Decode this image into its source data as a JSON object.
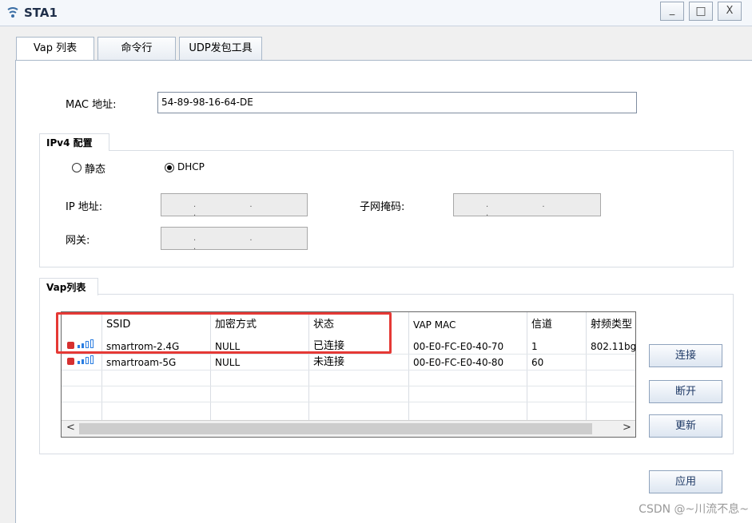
{
  "window": {
    "title": "STA1",
    "controls": {
      "minimize": "_",
      "maximize": "□",
      "close": "X"
    }
  },
  "tabs": [
    {
      "label": "Vap 列表"
    },
    {
      "label": "命令行"
    },
    {
      "label": "UDP发包工具"
    }
  ],
  "mac": {
    "label": "MAC 地址:",
    "value": "54-89-98-16-64-DE"
  },
  "ipv4": {
    "group_title": "IPv4 配置",
    "static_label": "静态",
    "dhcp_label": "DHCP",
    "selected": "DHCP",
    "ip_label": "IP 地址:",
    "mask_label": "子网掩码:",
    "gateway_label": "网关:",
    "ip_dots": ". . .",
    "mask_dots": ". . .",
    "gateway_dots": ". . ."
  },
  "vap": {
    "group_title": "Vap列表",
    "columns": [
      "SSID",
      "加密方式",
      "状态",
      "VAP MAC",
      "信道",
      "射频类型"
    ],
    "rows": [
      {
        "ssid": "smartrom-2.4G",
        "enc": "NULL",
        "status": "已连接",
        "mac": "00-E0-FC-E0-40-70",
        "channel": "1",
        "radio": "802.11bg"
      },
      {
        "ssid": "smartroam-5G",
        "enc": "NULL",
        "status": "未连接",
        "mac": "00-E0-FC-E0-40-80",
        "channel": "60",
        "radio": ""
      }
    ],
    "scroll_left": "<",
    "scroll_right": ">"
  },
  "buttons": {
    "connect": "连接",
    "disconnect": "断开",
    "refresh": "更新",
    "apply": "应用"
  },
  "watermark": "CSDN @~川流不息~",
  "colors": {
    "highlight_box": "#e53935",
    "signal": "#2a7de1",
    "lock": "#d63030"
  }
}
